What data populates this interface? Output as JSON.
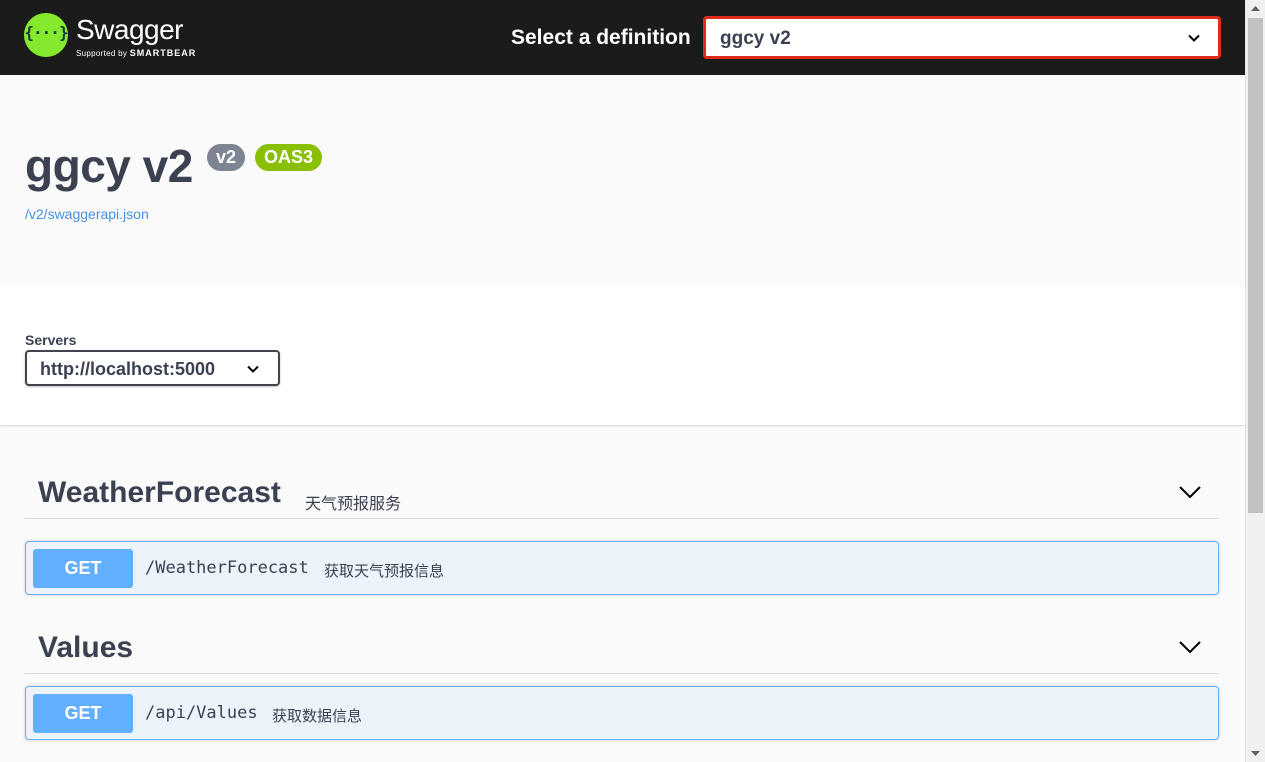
{
  "topbar": {
    "logo_name": "Swagger",
    "logo_sub_prefix": "Supported by",
    "logo_sub_brand": "SMARTBEAR",
    "select_label": "Select a definition",
    "selected_definition": "ggcy v2",
    "highlight_color": "#e3291c",
    "logo_icon": "swagger-braces-icon"
  },
  "info": {
    "title": "ggcy v2",
    "version_badge": "v2",
    "oas_badge": "OAS3",
    "spec_url": "/v2/swaggerapi.json"
  },
  "servers": {
    "label": "Servers",
    "selected": "http://localhost:5000"
  },
  "tags": [
    {
      "name": "WeatherForecast",
      "description": "天气预报服务",
      "operations": [
        {
          "method": "GET",
          "path": "/WeatherForecast",
          "summary": "获取天气预报信息"
        }
      ]
    },
    {
      "name": "Values",
      "description": "",
      "operations": [
        {
          "method": "GET",
          "path": "/api/Values",
          "summary": "获取数据信息"
        }
      ]
    }
  ],
  "colors": {
    "get_method": "#61affe",
    "get_background": "#ebf3fb",
    "version_badge": "#7d8492",
    "oas_badge": "#89bf04",
    "logo_green": "#85ea2d"
  }
}
